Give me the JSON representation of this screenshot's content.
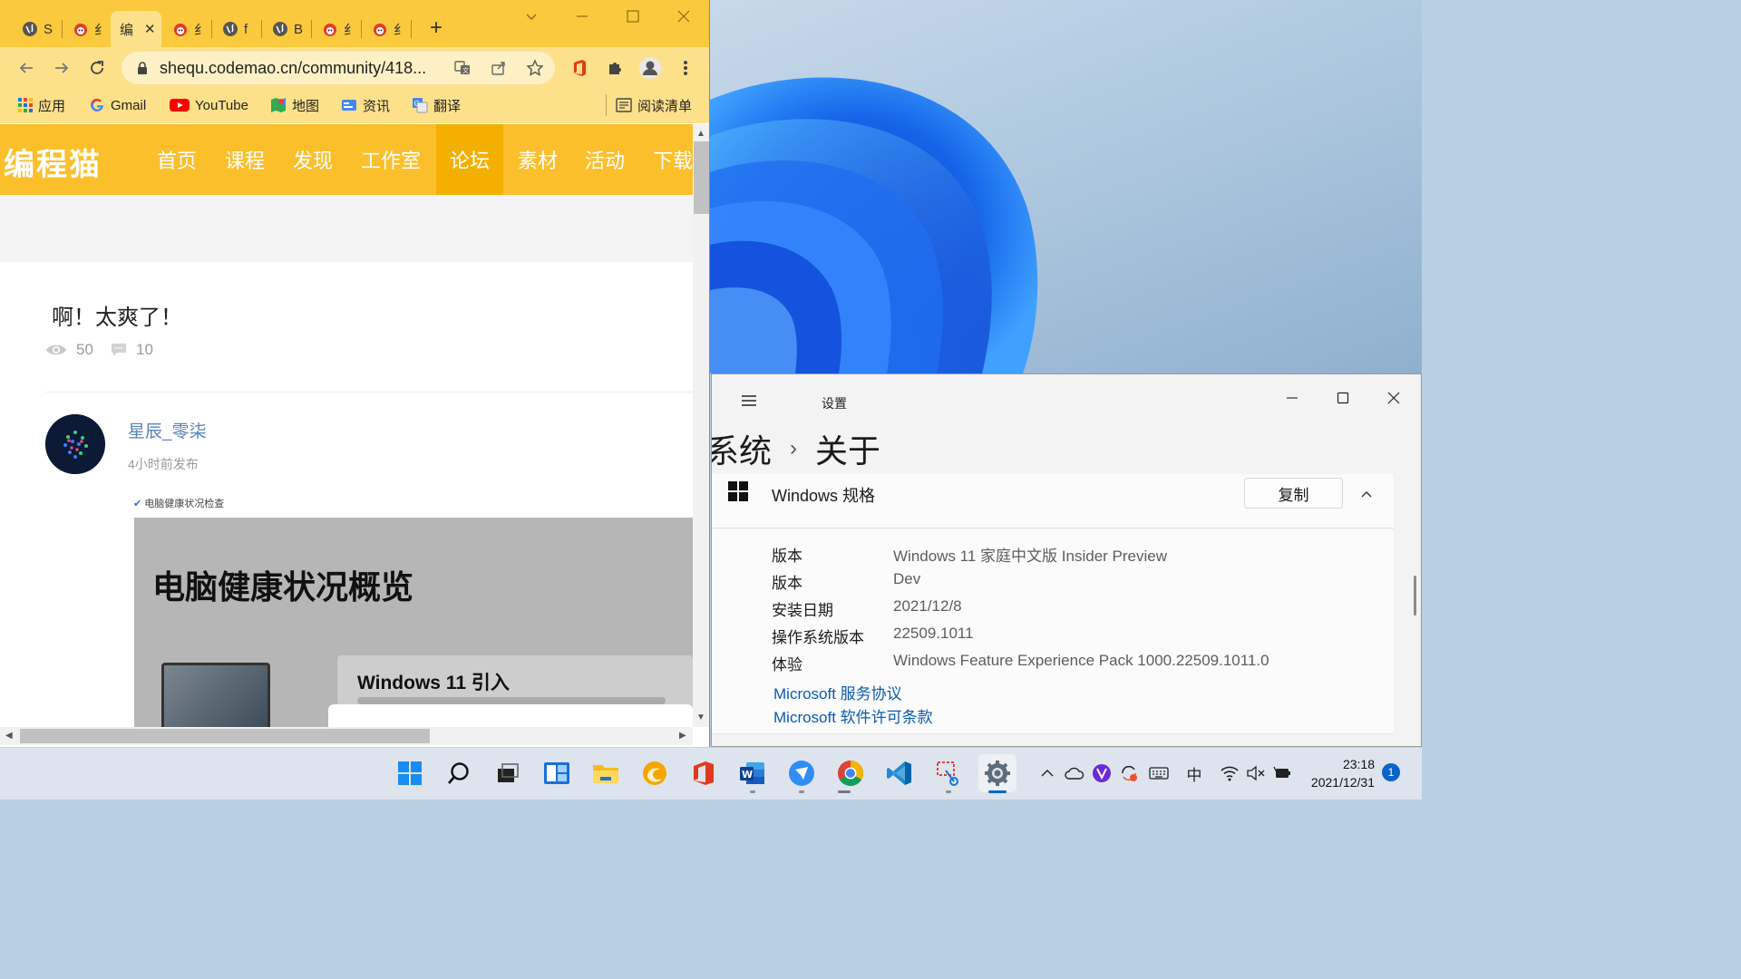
{
  "browser": {
    "tabs": [
      {
        "label": "S",
        "icon": "globe-icon"
      },
      {
        "label": "纟",
        "icon": "codemao-cat-icon"
      },
      {
        "label": "编",
        "icon": "codemao-cat-icon",
        "active": true
      },
      {
        "label": "纟",
        "icon": "codemao-cat-icon"
      },
      {
        "label": "f",
        "icon": "globe-icon"
      },
      {
        "label": "B",
        "icon": "globe-icon"
      },
      {
        "label": "纟",
        "icon": "codemao-cat-icon"
      },
      {
        "label": "纟",
        "icon": "codemao-cat-icon"
      }
    ],
    "close_tab_glyph": "✕",
    "new_tab_glyph": "+",
    "url": "shequ.codemao.cn/community/418...",
    "bookmarks": [
      {
        "label": "应用",
        "icon": "apps-grid-icon"
      },
      {
        "label": "Gmail",
        "icon": "google-icon"
      },
      {
        "label": "YouTube",
        "icon": "youtube-icon"
      },
      {
        "label": "地图",
        "icon": "maps-icon"
      },
      {
        "label": "资讯",
        "icon": "news-icon"
      },
      {
        "label": "翻译",
        "icon": "translate-icon"
      }
    ],
    "reading_list": "阅读清单"
  },
  "site": {
    "logo": "编程猫",
    "nav": [
      "首页",
      "课程",
      "发现",
      "工作室",
      "论坛",
      "素材",
      "活动",
      "下载"
    ],
    "active_nav": "论坛",
    "post": {
      "title": "啊！太爽了！",
      "views": "50",
      "comments": "10",
      "author": "星辰_零柒",
      "time": "4小时前发布",
      "screenshot": {
        "top_text": "电脑健康状况检查",
        "title": "电脑健康状况概览",
        "card_title": "Windows 11 引入"
      }
    }
  },
  "settings": {
    "window_title": "设置",
    "breadcrumb": {
      "parent": "系统",
      "separator": "›",
      "current": "关于"
    },
    "section_title": "Windows 规格",
    "copy_label": "复制",
    "specs": [
      {
        "key": "版本",
        "value": "Windows 11 家庭中文版 Insider Preview"
      },
      {
        "key": "版本",
        "value": "Dev"
      },
      {
        "key": "安装日期",
        "value": "2021/12/8"
      },
      {
        "key": "操作系统版本",
        "value": "22509.1011"
      },
      {
        "key": "体验",
        "value": "Windows Feature Experience Pack 1000.22509.1011.0"
      }
    ],
    "links": [
      "Microsoft 服务协议",
      "Microsoft 软件许可条款"
    ]
  },
  "taskbar": {
    "apps": [
      "start-icon",
      "search-icon",
      "task-view-icon",
      "widgets-icon",
      "file-explorer-icon",
      "edge-canary-icon",
      "office-icon",
      "word-icon",
      "feishu-icon",
      "chrome-icon",
      "vscode-icon",
      "snipping-tool-icon",
      "settings-icon"
    ],
    "ime": "中",
    "time": "23:18",
    "date": "2021/12/31",
    "notifications": "1"
  },
  "colors": {
    "brand_yellow": "#fcbf2c",
    "chrome_tabbar": "#fbc93d",
    "link_blue": "#0b5bb0"
  }
}
